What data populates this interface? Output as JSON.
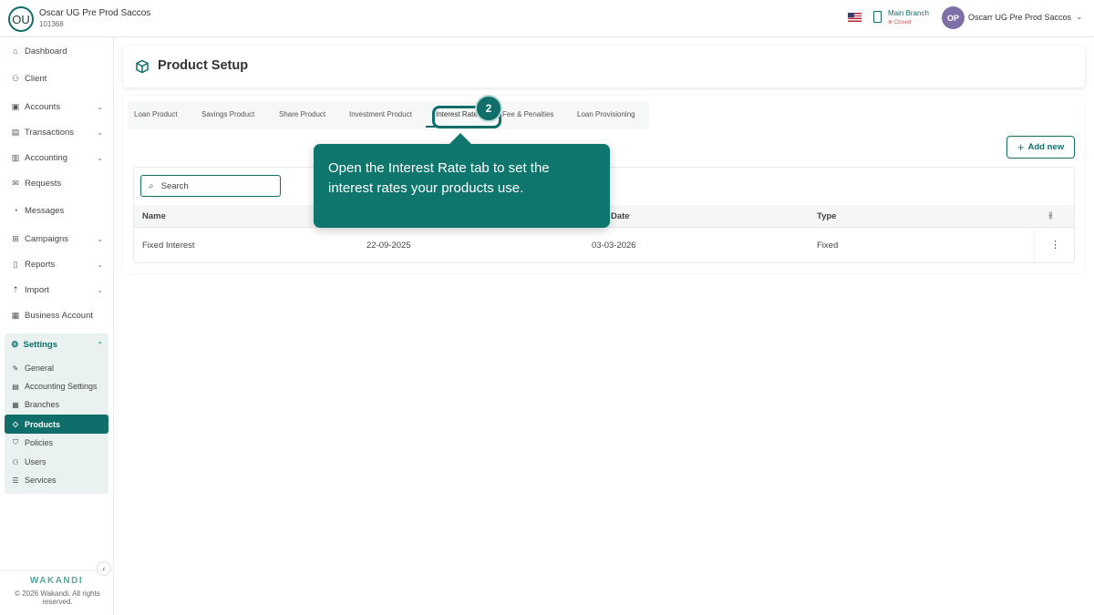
{
  "header": {
    "org_initials": "OU",
    "org_name": "Oscar UG Pre Prod Saccos",
    "org_id": "101368",
    "branch_name": "Main Branch",
    "branch_status": "Closed",
    "user_initials": "OP",
    "user_name": "Oscarr UG Pre Prod Saccos"
  },
  "sidebar": {
    "items": [
      {
        "label": "Dashboard",
        "icon": "home-icon"
      },
      {
        "label": "Client",
        "icon": "users-icon"
      },
      {
        "label": "Accounts",
        "icon": "briefcase-icon"
      },
      {
        "label": "Transactions",
        "icon": "money-icon"
      },
      {
        "label": "Accounting",
        "icon": "ledger-icon"
      },
      {
        "label": "Requests",
        "icon": "mail-icon"
      },
      {
        "label": "Messages",
        "icon": "chat-icon"
      },
      {
        "label": "Campaigns",
        "icon": "grid-icon"
      },
      {
        "label": "Reports",
        "icon": "chart-icon"
      },
      {
        "label": "Import",
        "icon": "upload-icon"
      },
      {
        "label": "Business Account",
        "icon": "building-icon"
      }
    ],
    "settings": {
      "label": "Settings",
      "items": [
        {
          "label": "General",
          "icon": "wrench-icon"
        },
        {
          "label": "Accounting Settings",
          "icon": "document-icon"
        },
        {
          "label": "Branches",
          "icon": "building-icon"
        },
        {
          "label": "Products",
          "icon": "tag-icon"
        },
        {
          "label": "Policies",
          "icon": "shield-icon"
        },
        {
          "label": "Users",
          "icon": "users-icon"
        },
        {
          "label": "Services",
          "icon": "list-icon"
        }
      ]
    },
    "brand": "WAKANDI",
    "copyright": "© 2026 Wakandi. All rights reserved."
  },
  "page": {
    "title": "Product Setup",
    "tabs": [
      {
        "label": "Loan Product"
      },
      {
        "label": "Savings Product"
      },
      {
        "label": "Share Product"
      },
      {
        "label": "Investment Product"
      },
      {
        "label": "Interest Rate"
      },
      {
        "label": "Fee & Penalties"
      },
      {
        "label": "Loan Provisioning"
      }
    ],
    "add_label": "Add new",
    "search_placeholder": "Search",
    "table": {
      "columns": [
        "Name",
        "",
        "Date",
        "Type"
      ],
      "rows": [
        {
          "name": "Fixed Interest",
          "start": "22-09-2025",
          "end": "03-03-2026",
          "type": "Fixed"
        }
      ]
    }
  },
  "guide": {
    "step": "2",
    "text": "Open the Interest Rate tab to set the interest rates your products use."
  },
  "colors": {
    "accent": "#0f6e6a",
    "tooltip": "#0f766e"
  }
}
